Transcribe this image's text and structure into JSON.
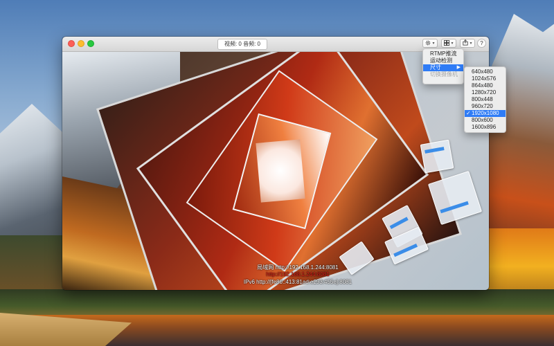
{
  "window": {
    "stats": "视频: 0 音频: 0",
    "toolbar": {
      "gear_icon": "gear-icon",
      "layout_icon": "layout-grid-icon",
      "share_icon": "share-icon",
      "help_label": "?"
    }
  },
  "overlay": {
    "lan": "局域网 http://192.168.1.244:8081",
    "red": "http://192.168.1.244:8081",
    "ipv6": "IPv6 http://[fe80::413:81ad:e293:455e]:8081"
  },
  "gear_menu": {
    "items": [
      {
        "label": "RTMP推流",
        "state": "normal"
      },
      {
        "label": "运动检测",
        "state": "normal"
      },
      {
        "label": "尺寸",
        "state": "highlighted",
        "submenu": true
      },
      {
        "label": "切换摄像机",
        "state": "disabled"
      }
    ]
  },
  "size_menu": {
    "selected": "1920x1080",
    "items": [
      "640x480",
      "1024x576",
      "864x480",
      "1280x720",
      "800x448",
      "960x720",
      "1920x1080",
      "800x600",
      "1600x896"
    ]
  },
  "colors": {
    "highlight": "#2f7cf6",
    "overlay_red": "#e8231a"
  }
}
